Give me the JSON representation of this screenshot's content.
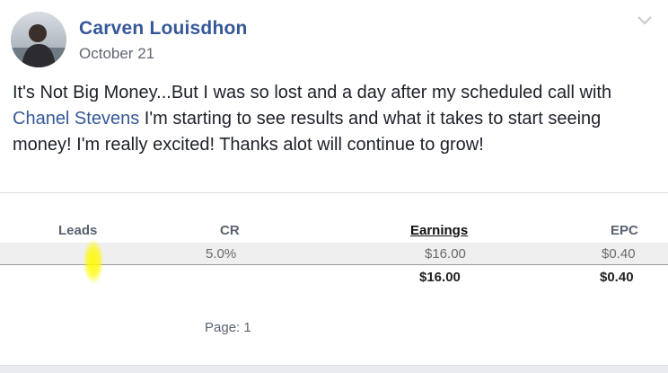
{
  "post": {
    "author": "Carven Louisdhon",
    "date": "October 21",
    "text_before": "It's Not Big Money...But I was so lost and a day after my scheduled call with ",
    "mention": "Chanel Stevens",
    "text_after": " I'm starting to see results and what it takes to start seeing money! I'm really excited! Thanks alot will continue to grow!"
  },
  "report": {
    "columns": [
      "Leads",
      "CR",
      "Earnings",
      "EPC"
    ],
    "row": {
      "leads": "",
      "cr": "5.0%",
      "earnings": "$16.00",
      "epc": "$0.40"
    },
    "totals": {
      "earnings": "$16.00",
      "epc": "$0.40"
    },
    "page_label": "Page:",
    "page_number": "1"
  },
  "colors": {
    "link": "#365899",
    "highlight": "#ffff00"
  },
  "icons": {
    "menu": "chevron-down-icon"
  }
}
